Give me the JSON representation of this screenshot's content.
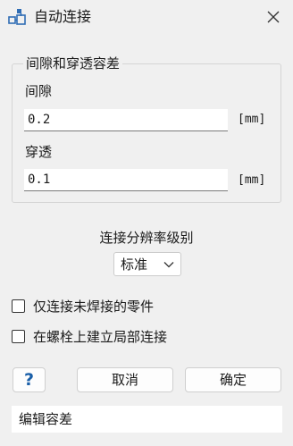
{
  "window": {
    "title": "自动连接",
    "app_icon": "connection-tool-icon",
    "close_icon": "close-icon"
  },
  "clearance_group": {
    "legend": "间隙和穿透容差",
    "gap": {
      "label": "间隙",
      "value": "0.2",
      "unit": "[mm]"
    },
    "penetration": {
      "label": "穿透",
      "value": "0.1",
      "unit": "[mm]"
    }
  },
  "resolution": {
    "label": "连接分辨率级别",
    "selected": "标准",
    "chevron_icon": "chevron-down-icon"
  },
  "options": {
    "unwelded_only": {
      "label": "仅连接未焊接的零件",
      "checked": false
    },
    "bolt_local": {
      "label": "在螺栓上建立局部连接",
      "checked": false
    }
  },
  "buttons": {
    "help": "?",
    "cancel": "取消",
    "ok": "确定"
  },
  "status": {
    "text": "编辑容差"
  },
  "colors": {
    "background": "#f0f0f0",
    "help_accent": "#1a5fa8",
    "icon_blue": "#2f6db5"
  }
}
